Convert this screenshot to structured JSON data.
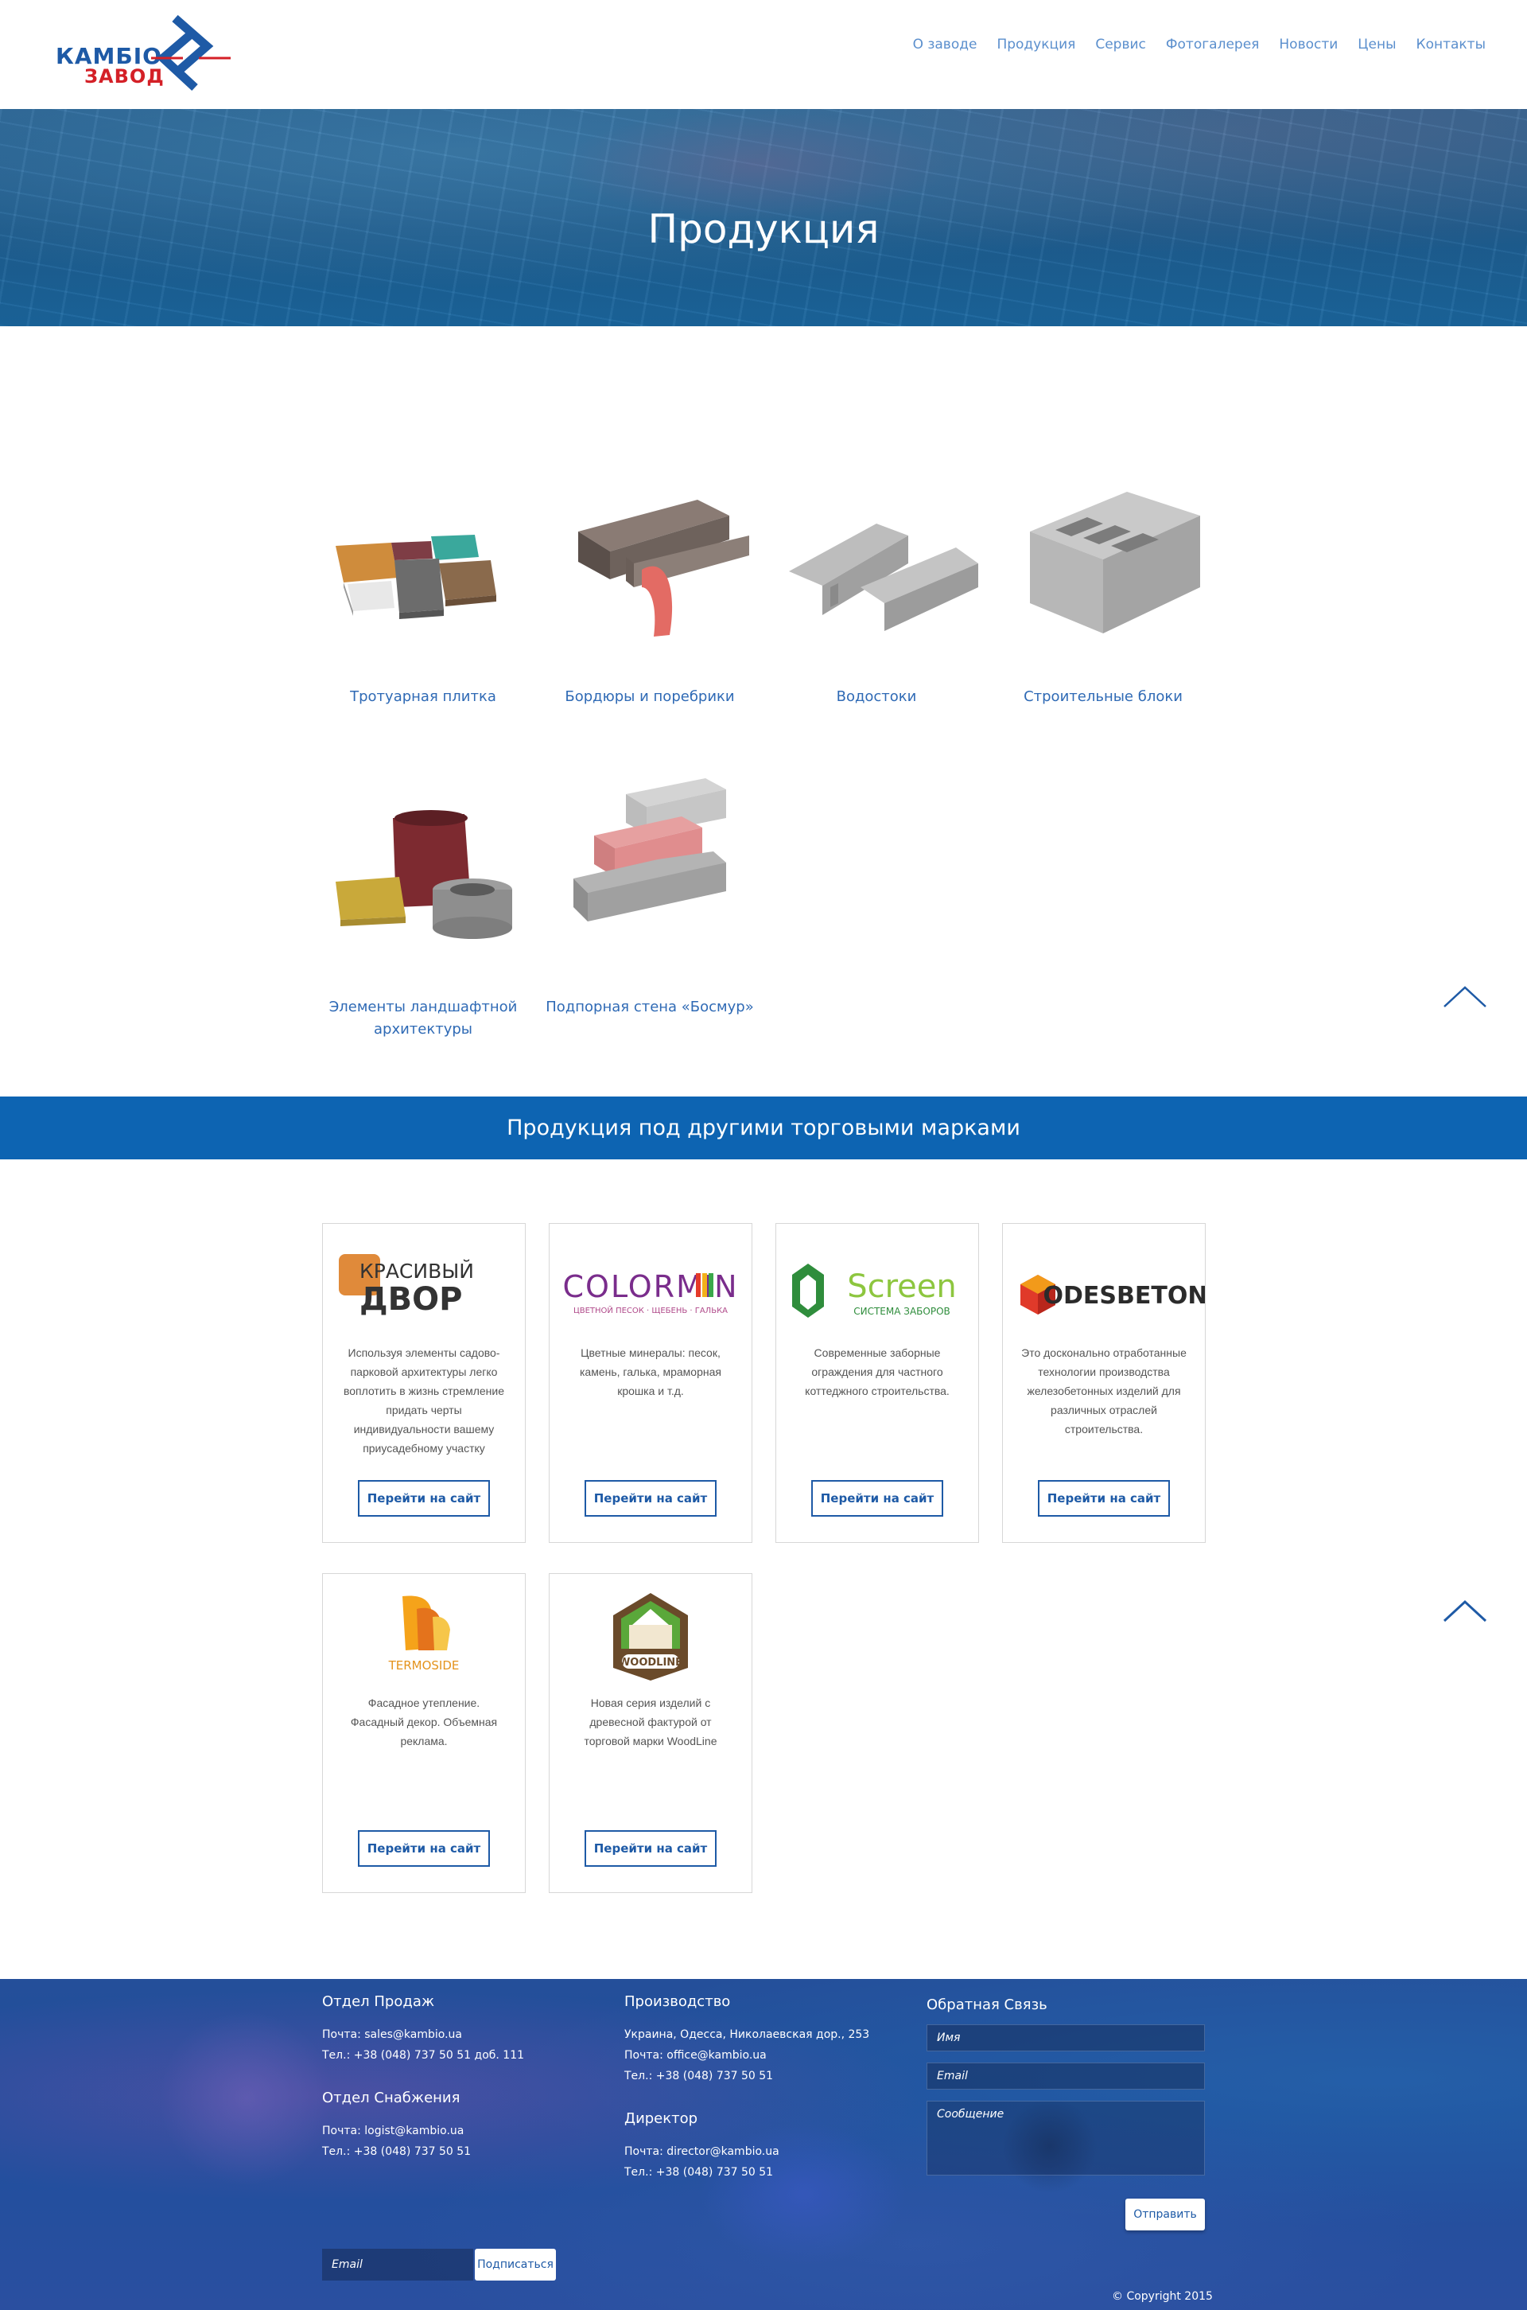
{
  "header": {
    "logo_top": "КАМБІО",
    "logo_bottom": "ЗАВОД",
    "nav": [
      "О заводе",
      "Продукция",
      "Сервис",
      "Фотогалерея",
      "Новости",
      "Цены",
      "Контакты"
    ]
  },
  "hero": {
    "title": "Продукция"
  },
  "products": [
    {
      "label": "Тротуарная плитка",
      "image_icon": "paving-tiles-image"
    },
    {
      "label": "Бордюры и поребрики",
      "image_icon": "curbs-image"
    },
    {
      "label": "Водостоки",
      "image_icon": "drains-image"
    },
    {
      "label": "Строительные блоки",
      "image_icon": "building-block-image"
    },
    {
      "label": "Элементы ландшафтной архитектуры",
      "image_icon": "landscape-elements-image"
    },
    {
      "label": "Подпорная стена «Босмур»",
      "image_icon": "retaining-wall-image"
    }
  ],
  "brands": {
    "title": "Продукция под другими торговыми марками",
    "button_label": "Перейти на сайт",
    "items": [
      {
        "logo": "КРАСИВЫЙ ДВОР",
        "logo_line1": "КРАСИВЫЙ",
        "logo_line2": "ДВОР",
        "desc": "Используя элементы садово-парковой архитектуры легко воплотить в жизнь стремление придать черты индивидуальности вашему приусадебному участку"
      },
      {
        "logo": "COLORMIN",
        "logo_sub": "ЦВЕТНОЙ ПЕСОК · ЩЕБЕНЬ · ГАЛЬКА",
        "desc": "Цветные минералы: песок, камень, галька, мраморная крошка и т.д."
      },
      {
        "logo": "Screen",
        "logo_sub": "СИСТЕМА ЗАБОРОВ",
        "desc": "Современные заборные ограждения для частного коттеджного строительства."
      },
      {
        "logo": "ODESBETON",
        "desc": "Это досконально отработанные технологии производства железобетонных изделий для различных отраслей строительства."
      },
      {
        "logo": "TERMOSIDE",
        "desc": "Фасадное утепление. Фасадный декор. Объемная реклама."
      },
      {
        "logo": "WOODLINE",
        "desc": "Новая серия изделий с древесной фактурой от торговой марки WoodLine"
      }
    ]
  },
  "footer": {
    "sales": {
      "title": "Отдел Продаж",
      "email": "Почта: sales@kambio.ua",
      "phone": "Тел.: +38 (048) 737 50 51 доб. 111"
    },
    "supply": {
      "title": "Отдел Снабжения",
      "email": "Почта: logist@kambio.ua",
      "phone": "Тел.: +38 (048) 737 50 51"
    },
    "production": {
      "title": "Производство",
      "address": "Украина, Одесса, Николаевская дор., 253",
      "email": "Почта: office@kambio.ua",
      "phone": "Тел.: +38 (048) 737 50 51"
    },
    "director": {
      "title": "Директор",
      "email": "Почта: director@kambio.ua",
      "phone": "Тел.: +38 (048) 737 50 51"
    },
    "feedback": {
      "title": "Обратная Связь",
      "name_placeholder": "Имя",
      "email_placeholder": "Email",
      "message_placeholder": "Сообщение",
      "send_label": "Отправить"
    },
    "subscribe": {
      "placeholder": "Email",
      "button_label": "Подписаться"
    },
    "copyright": "© Copyright 2015"
  },
  "colors": {
    "accent": "#0d64b2",
    "brand_blue": "#1e5aa6",
    "brand_red": "#d42027",
    "link": "#2f6ab5"
  }
}
